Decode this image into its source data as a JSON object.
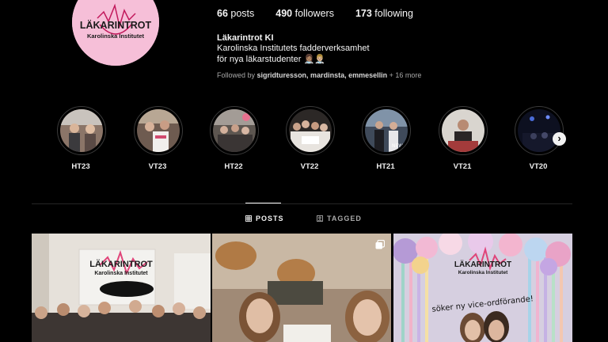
{
  "profile": {
    "avatar_text_main": "LÄKARINTROT",
    "avatar_text_sub": "Karolinska Institutet",
    "stats": {
      "posts_count": "66",
      "posts_label": "posts",
      "followers_count": "490",
      "followers_label": "followers",
      "following_count": "173",
      "following_label": "following"
    },
    "name": "Läkarintrot KI",
    "bio_line1": "Karolinska Institutets fadderverksamhet",
    "bio_line2": "för nya läkarstudenter 👩🏽‍⚕️👨🏼‍⚕️",
    "followed_by_prefix": "Followed by",
    "followed_by_names": "sigridturesson, mardinsta, emmesellin",
    "followed_by_more": "+ 16 more"
  },
  "highlights": [
    {
      "label": "HT23"
    },
    {
      "label": "VT23"
    },
    {
      "label": "HT22"
    },
    {
      "label": "VT22"
    },
    {
      "label": "HT21"
    },
    {
      "label": "VT21"
    },
    {
      "label": "VT20"
    }
  ],
  "highlights_next_icon": "chevron-right-icon",
  "tabs": {
    "posts": "POSTS",
    "tagged": "TAGGED"
  },
  "posts": [
    {
      "overlay_main": "LÄKARINTROT",
      "overlay_sub": "Karolinska Institutet"
    },
    {
      "multi_icon": "carousel-icon"
    },
    {
      "overlay_main": "LÄKARINTROT",
      "overlay_sub": "Karolinska Institutet",
      "caption": "söker ny vice-ordförande!"
    }
  ],
  "colors": {
    "background": "#000000",
    "accent_pink": "#f6bfd8",
    "muted": "#a8a8a8"
  }
}
